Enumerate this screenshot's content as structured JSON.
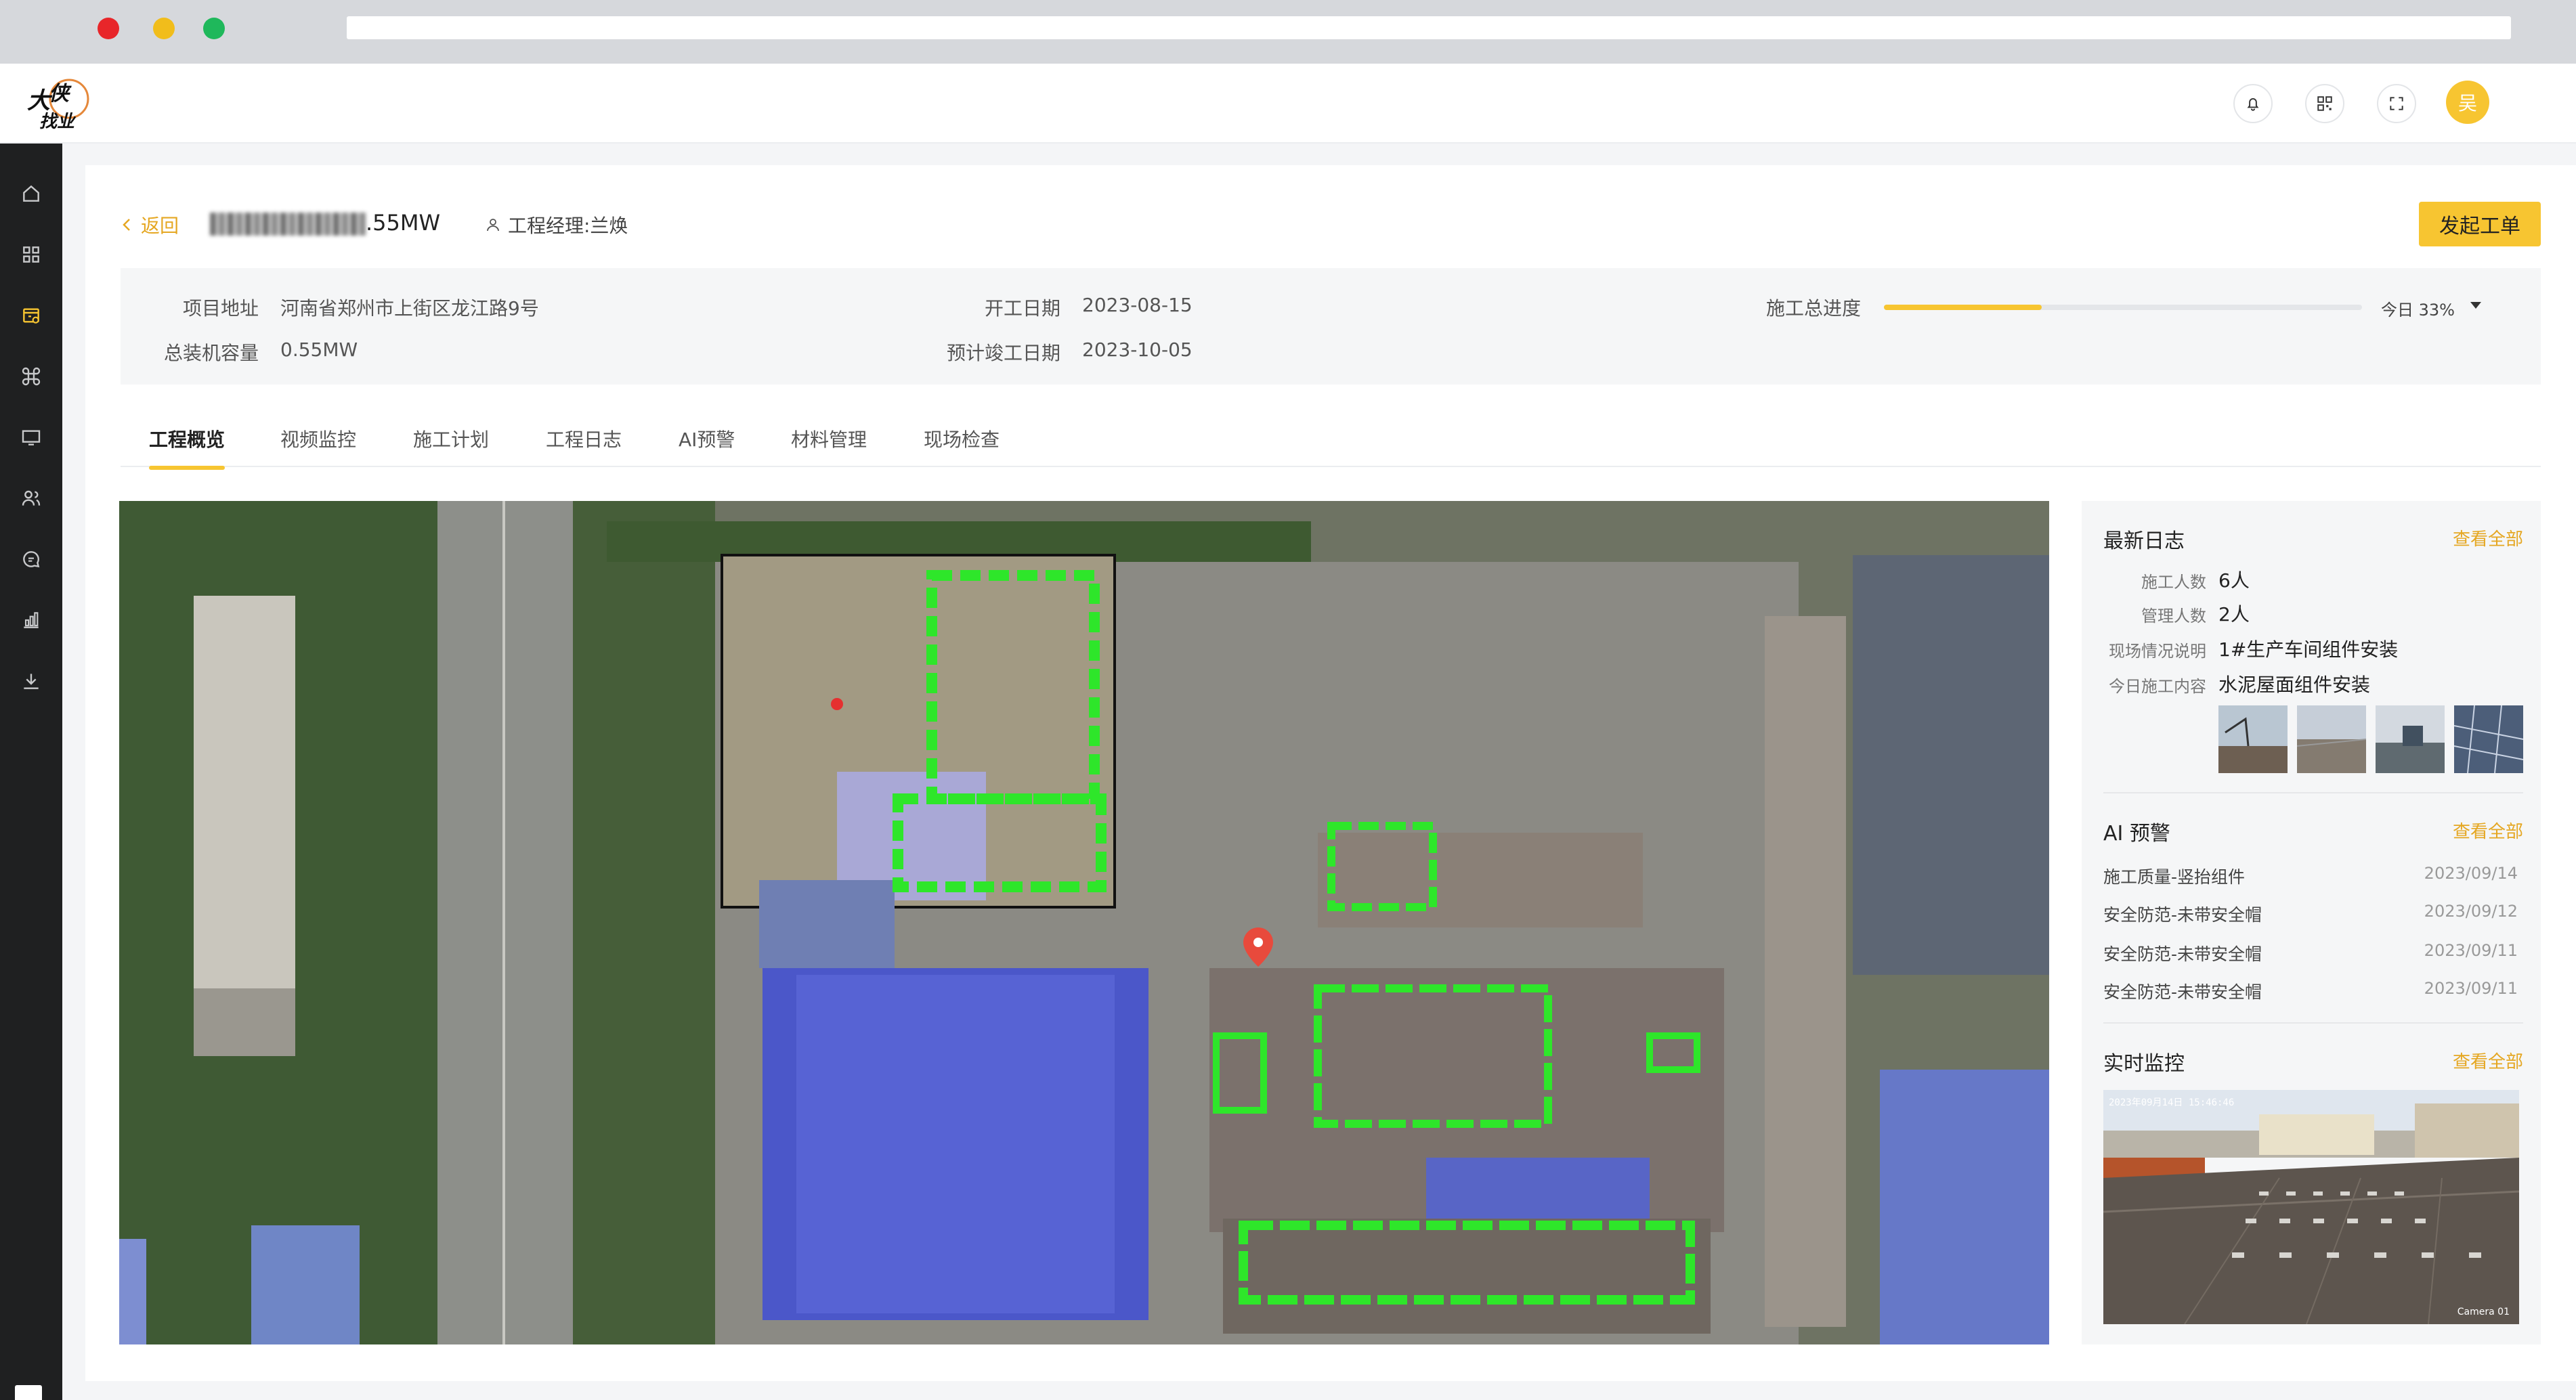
{
  "header": {
    "logo_alt": "大侠找业",
    "user_initial": "吴",
    "icons": [
      "bell-icon",
      "qr-code-icon",
      "fullscreen-icon"
    ]
  },
  "sidebar": {
    "items": [
      "home-icon",
      "grid-icon",
      "project-icon",
      "command-icon",
      "monitor-icon",
      "users-icon",
      "message-icon",
      "chart-icon",
      "download-icon"
    ]
  },
  "project": {
    "back_label": "返回",
    "title_suffix": ".55MW",
    "manager": "工程经理:兰焕",
    "work_order_button": "发起工单"
  },
  "info": {
    "address_label": "项目地址",
    "address": "河南省郑州市上街区龙江路9号",
    "capacity_label": "总装机容量",
    "capacity": "0.55MW",
    "start_label": "开工日期",
    "start_date": "2023-08-15",
    "end_label": "预计竣工日期",
    "end_date": "2023-10-05",
    "progress_label": "施工总进度",
    "progress_text": "今日 33%",
    "progress_value": 0.33
  },
  "tabs": [
    "工程概览",
    "视频监控",
    "施工计划",
    "工程日志",
    "AI预警",
    "材料管理",
    "现场检查"
  ],
  "log": {
    "title": "最新日志",
    "view_all": "查看全部",
    "rows": [
      {
        "label": "施工人数",
        "value": "6人"
      },
      {
        "label": "管理人数",
        "value": "2人"
      },
      {
        "label": "现场情况说明",
        "value": "1#生产车间组件安装"
      },
      {
        "label": "今日施工内容",
        "value": "水泥屋面组件安装"
      }
    ]
  },
  "ai": {
    "title": "AI 预警",
    "view_all": "查看全部",
    "items": [
      {
        "text": "施工质量-竖抬组件",
        "date": "2023/09/14"
      },
      {
        "text": "安全防范-未带安全帽",
        "date": "2023/09/12"
      },
      {
        "text": "安全防范-未带安全帽",
        "date": "2023/09/11"
      },
      {
        "text": "安全防范-未带安全帽",
        "date": "2023/09/11"
      }
    ]
  },
  "live": {
    "title": "实时监控",
    "view_all": "查看全部",
    "timestamp": "2023年09月14日 15:46:46",
    "camera": "Camera 01"
  },
  "colors": {
    "accent": "#f7c531",
    "link": "#e5a722",
    "sidebar": "#1f2021"
  }
}
